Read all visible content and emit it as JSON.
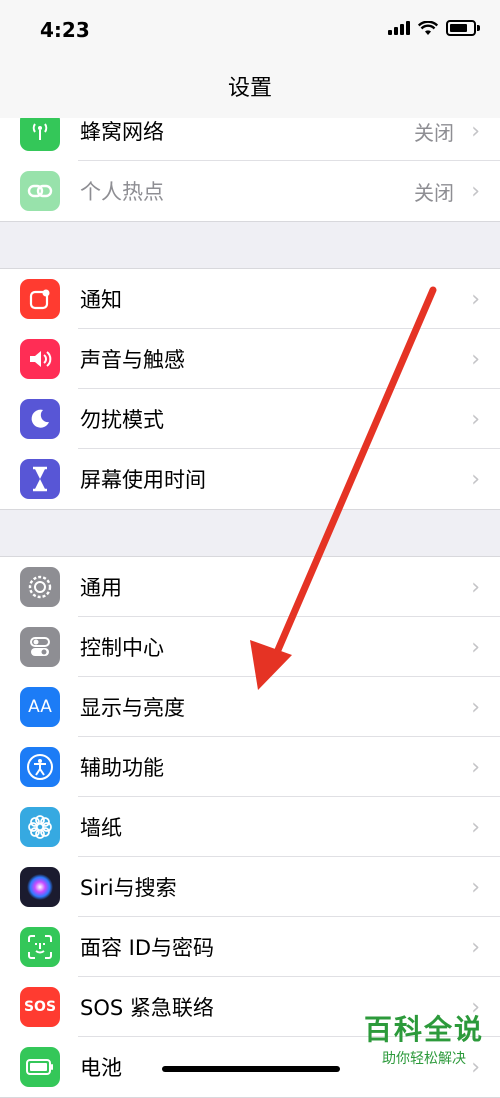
{
  "status": {
    "time": "4:23"
  },
  "header": {
    "title": "设置"
  },
  "groups": [
    {
      "items": [
        {
          "label": "蜂窝网络",
          "value": "关闭",
          "icon": "cellular-antenna-icon",
          "color": "#34c759"
        },
        {
          "label": "个人热点",
          "value": "关闭",
          "icon": "hotspot-link-icon",
          "color": "#34c759"
        }
      ]
    },
    {
      "items": [
        {
          "label": "通知",
          "icon": "notification-icon",
          "color": "#ff3b30"
        },
        {
          "label": "声音与触感",
          "icon": "speaker-icon",
          "color": "#ff2d55"
        },
        {
          "label": "勿扰模式",
          "icon": "moon-icon",
          "color": "#5856d6"
        },
        {
          "label": "屏幕使用时间",
          "icon": "hourglass-icon",
          "color": "#5856d6"
        }
      ]
    },
    {
      "items": [
        {
          "label": "通用",
          "icon": "gear-icon",
          "color": "#8e8e93"
        },
        {
          "label": "控制中心",
          "icon": "toggles-icon",
          "color": "#8e8e93"
        },
        {
          "label": "显示与亮度",
          "icon": "text-size-icon",
          "color": "#1c7cf6",
          "glyph": "AA"
        },
        {
          "label": "辅助功能",
          "icon": "accessibility-icon",
          "color": "#1c7cf6"
        },
        {
          "label": "墙纸",
          "icon": "flower-icon",
          "color": "#36a9e1"
        },
        {
          "label": "Siri与搜索",
          "icon": "siri-icon",
          "color": "#1b1b2f"
        },
        {
          "label": "面容 ID与密码",
          "icon": "face-id-icon",
          "color": "#34c759"
        },
        {
          "label": "SOS 紧急联络",
          "icon": "sos-icon",
          "color": "#ff3b30",
          "glyph": "SOS"
        },
        {
          "label": "电池",
          "icon": "battery-icon",
          "color": "#34c759"
        }
      ]
    }
  ],
  "chevron": "›",
  "watermark": {
    "title": "百科全说",
    "subtitle": "助你轻松解决"
  }
}
